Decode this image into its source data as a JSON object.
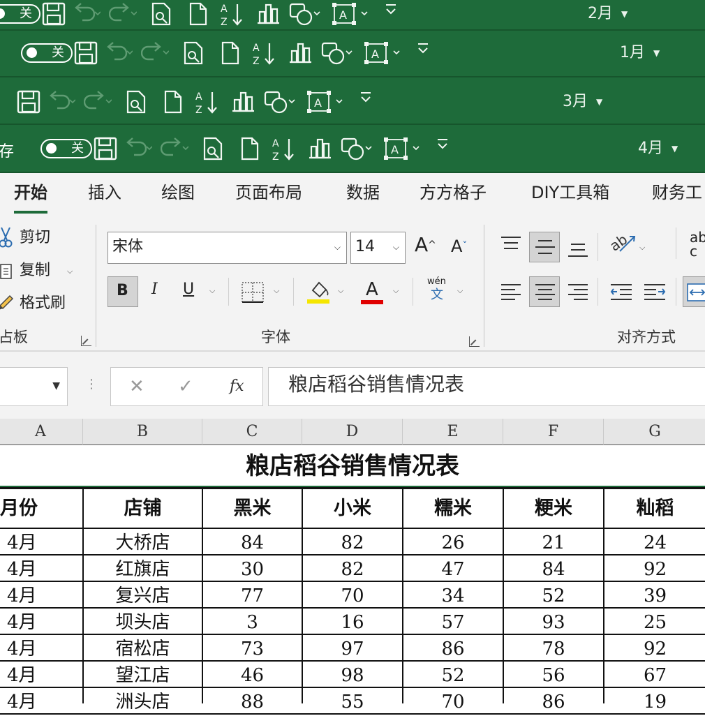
{
  "title_bars": [
    {
      "month": "2月",
      "toggle_label": "关"
    },
    {
      "month": "1月",
      "toggle_label": "关"
    },
    {
      "month": "3月"
    },
    {
      "month": "4月",
      "toggle_label": "关",
      "left_text": "存"
    }
  ],
  "ribbon_tabs": [
    "开始",
    "插入",
    "绘图",
    "页面布局",
    "数据",
    "方方格子",
    "DIY工具箱",
    "财务工"
  ],
  "clipboard": {
    "cut": "剪切",
    "copy": "复制",
    "format_painter": "格式刷",
    "group_name": "占板"
  },
  "font": {
    "name": "宋体",
    "size": "14",
    "bold": "B",
    "italic": "I",
    "underline": "U",
    "wen": "wén",
    "wen_char": "文",
    "font_color_letter": "A",
    "grow": "A",
    "shrink": "A",
    "group_name": "字体"
  },
  "alignment": {
    "group_name": "对齐方式",
    "ab": "ab",
    "c": "c"
  },
  "formula_bar": {
    "fx": "fx",
    "content": "粮店稻谷销售情况表"
  },
  "colors": {
    "title_green": "#1e6b3a",
    "highlight_yellow": "#f5e600",
    "font_red": "#e00000"
  },
  "columns": [
    "A",
    "B",
    "C",
    "D",
    "E",
    "F",
    "G"
  ],
  "sheet": {
    "title": "粮店稻谷销售情况表",
    "headers": [
      "月份",
      "店铺",
      "黑米",
      "小米",
      "糯米",
      "粳米",
      "籼稻"
    ],
    "rows": [
      [
        "4月",
        "大桥店",
        "84",
        "82",
        "26",
        "21",
        "24"
      ],
      [
        "4月",
        "红旗店",
        "30",
        "82",
        "47",
        "84",
        "92"
      ],
      [
        "4月",
        "复兴店",
        "77",
        "70",
        "34",
        "52",
        "39"
      ],
      [
        "4月",
        "坝头店",
        "3",
        "16",
        "57",
        "93",
        "25"
      ],
      [
        "4月",
        "宿松店",
        "73",
        "97",
        "86",
        "78",
        "92"
      ],
      [
        "4月",
        "望江店",
        "46",
        "98",
        "52",
        "56",
        "67"
      ],
      [
        "4月",
        "洲头店",
        "88",
        "55",
        "70",
        "86",
        "19"
      ]
    ]
  }
}
